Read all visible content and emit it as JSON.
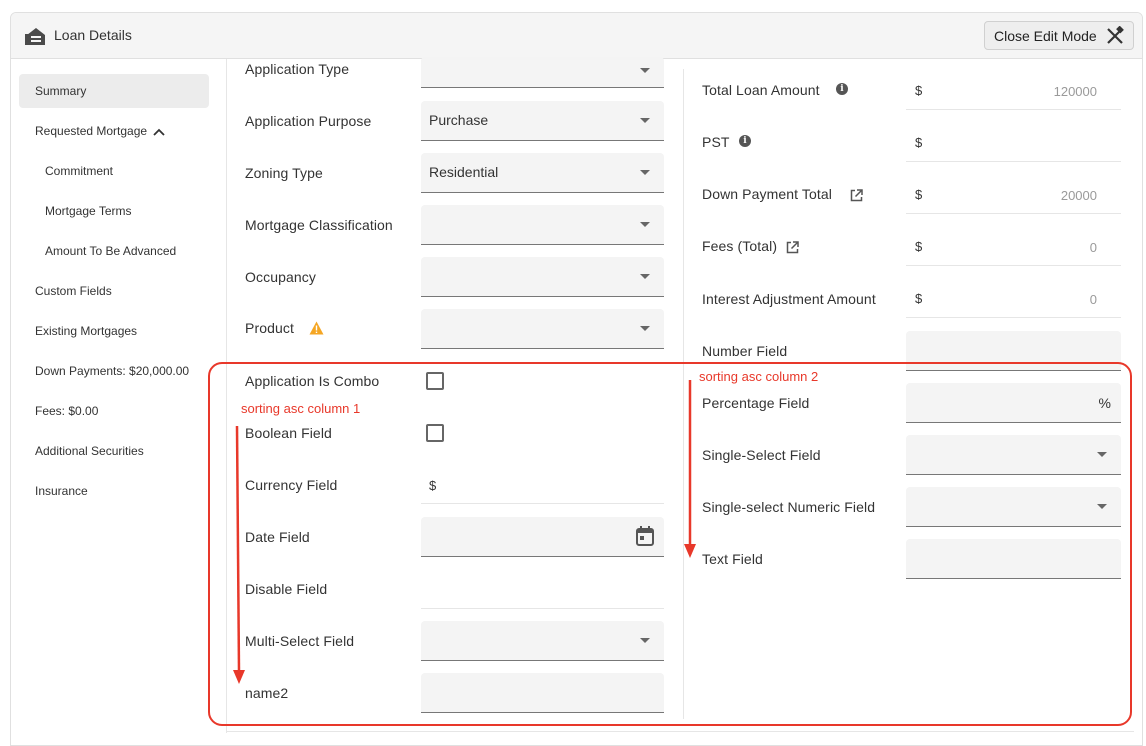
{
  "header": {
    "title": "Loan Details",
    "close_edit_label": "Close Edit Mode"
  },
  "sidebar": {
    "items": [
      {
        "label": "Summary",
        "active": true
      },
      {
        "label": "Requested Mortgage"
      },
      {
        "label": "Commitment"
      },
      {
        "label": "Mortgage Terms"
      },
      {
        "label": "Amount To Be Advanced"
      },
      {
        "label": "Custom Fields"
      },
      {
        "label": "Existing Mortgages"
      },
      {
        "label": "Down Payments: $20,000.00"
      },
      {
        "label": "Fees: $0.00"
      },
      {
        "label": "Additional Securities"
      },
      {
        "label": "Insurance"
      }
    ]
  },
  "column1": {
    "application_type": {
      "label": "Application Type",
      "value": ""
    },
    "application_purpose": {
      "label": "Application Purpose",
      "value": "Purchase"
    },
    "zoning_type": {
      "label": "Zoning Type",
      "value": "Residential"
    },
    "mortgage_classification": {
      "label": "Mortgage Classification",
      "value": ""
    },
    "occupancy": {
      "label": "Occupancy",
      "value": ""
    },
    "product": {
      "label": "Product",
      "value": ""
    },
    "application_is_combo": {
      "label": "Application Is Combo",
      "checked": false
    },
    "boolean_field": {
      "label": "Boolean Field",
      "checked": false
    },
    "currency_field": {
      "label": "Currency Field",
      "prefix": "$"
    },
    "date_field": {
      "label": "Date Field"
    },
    "disable_field": {
      "label": "Disable Field"
    },
    "multi_select_field": {
      "label": "Multi-Select Field",
      "value": ""
    },
    "name2": {
      "label": "name2",
      "value": ""
    }
  },
  "column2": {
    "total_loan_amount": {
      "label": "Total Loan Amount",
      "prefix": "$",
      "value": "120000"
    },
    "pst": {
      "label": "PST",
      "prefix": "$",
      "value": ""
    },
    "down_payment_total": {
      "label": "Down Payment Total",
      "prefix": "$",
      "value": "20000"
    },
    "fees_total": {
      "label": "Fees (Total)",
      "prefix": "$",
      "value": "0"
    },
    "interest_adjustment_amount": {
      "label": "Interest Adjustment Amount",
      "prefix": "$",
      "value": "0"
    },
    "number_field": {
      "label": "Number Field",
      "value": ""
    },
    "percentage_field": {
      "label": "Percentage Field",
      "suffix": "%"
    },
    "single_select_field": {
      "label": "Single-Select Field",
      "value": ""
    },
    "single_select_numeric_field": {
      "label": "Single-select Numeric Field",
      "value": ""
    },
    "text_field": {
      "label": "Text Field",
      "value": ""
    }
  },
  "annotations": {
    "column1_note": "sorting asc column 1",
    "column2_note": "sorting asc column 2",
    "color": "#e8382a"
  },
  "colors": {
    "field_bg": "#f4f4f4",
    "active_nav_bg": "#ececec",
    "warning": "#f5a623"
  }
}
